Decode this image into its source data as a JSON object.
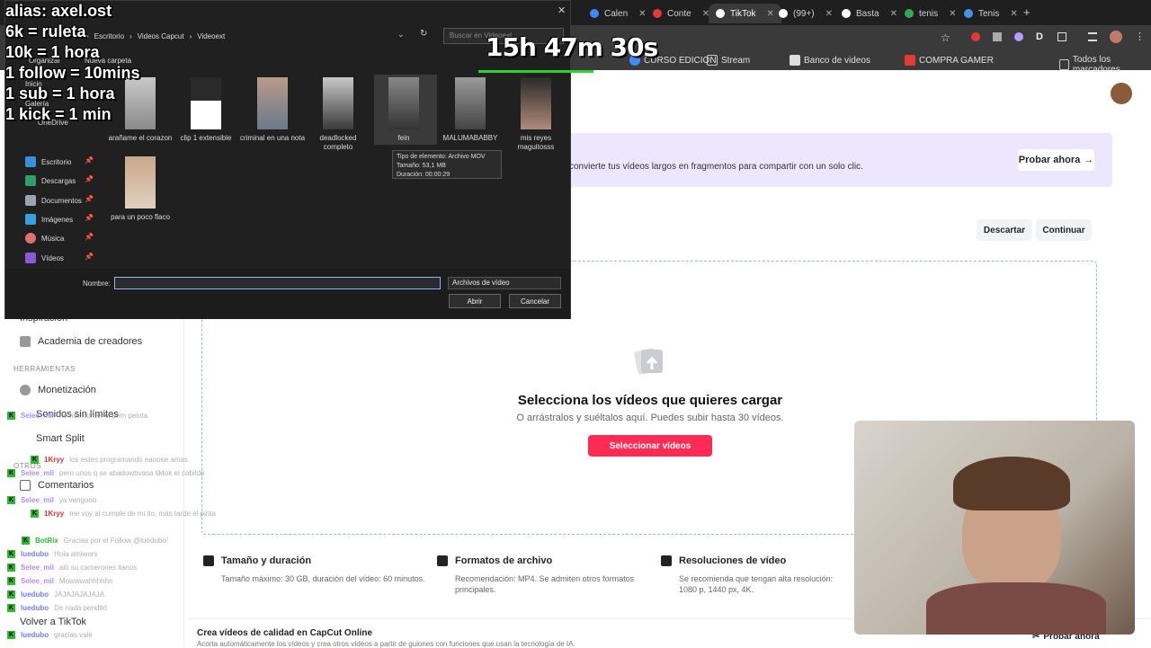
{
  "browser": {
    "tabs": [
      {
        "label": "Calen",
        "color": "#4285f4"
      },
      {
        "label": "Conte",
        "color": "#e53935"
      },
      {
        "label": "TikTok",
        "color": "#ffffff",
        "active": true
      },
      {
        "label": "(99+)",
        "color": "#ffffff"
      },
      {
        "label": "Basta",
        "color": "#ffffff"
      },
      {
        "label": "tenis",
        "color": "#34a853"
      },
      {
        "label": "Tenis",
        "color": "#4a90e2"
      }
    ],
    "bookmarks": [
      {
        "label": "CURSO EDICION",
        "color": "#3c8dff"
      },
      {
        "label": "Stream",
        "color": "#cccccc"
      },
      {
        "label": "Banco de videos",
        "color": "#cccccc"
      },
      {
        "label": "COMPRA GAMER",
        "color": "#e53935"
      },
      {
        "label": "Todos los marcadores",
        "color": "#cccccc"
      }
    ]
  },
  "dialog": {
    "path": [
      "Escritorio",
      "Videos Capcut",
      "Videoext"
    ],
    "search_placeholder": "Buscar en Videoext",
    "toolbar": {
      "organize": "Organizar",
      "new_folder": "Nueva carpeta"
    },
    "nav_top": [
      "Inicio",
      "Galería",
      "OneDrive"
    ],
    "nav_items": [
      "Escritorio",
      "Descargas",
      "Documentos",
      "Imágenes",
      "Música",
      "Vídeos"
    ],
    "files": [
      {
        "name": "arañame el corazon"
      },
      {
        "name": "clip 1 extensible"
      },
      {
        "name": "criminal en una nota"
      },
      {
        "name": "deadlocked completo"
      },
      {
        "name": "fein"
      },
      {
        "name": "MALUMABABBY"
      },
      {
        "name": "mis reyes maguitosss"
      },
      {
        "name": "para un poco flaco"
      }
    ],
    "tooltip": [
      "Tipo de elemento: Archivo MOV",
      "Tamaño: 53,1 MB",
      "Duración: 00:00:29"
    ],
    "name_label": "Nombre:",
    "name_value": "",
    "file_type": "Archivos de vídeo",
    "open_label": "Abrir",
    "cancel_label": "Cancelar"
  },
  "capcut": {
    "sidebar": {
      "items_top": [
        "Inspiración",
        "Academia de creadores"
      ],
      "section_tools": "HERRAMIENTAS",
      "tools": [
        "Monetización",
        "Sonidos sin límites",
        "Smart Split"
      ],
      "section_others": "OTROS",
      "others": [
        "Comentarios"
      ],
      "back": "Volver a TikTok"
    },
    "banner_text": "convierte tus vídeos largos en fragmentos para compartir con un solo clic.",
    "banner_button": "Probar ahora",
    "discard_label": "Descartar",
    "continue_label": "Continuar",
    "upload_title": "Selecciona los vídeos que quieres cargar",
    "upload_subtitle": "O arrástralos y suéltalos aquí. Puedes subir hasta 30 vídeos.",
    "upload_button": "Seleccionar vídeos",
    "features": [
      {
        "title": "Tamaño y duración",
        "text": "Tamaño máximo: 30 GB, duración del vídeo: 60 minutos."
      },
      {
        "title": "Formatos de archivo",
        "text": "Recomendación: MP4. Se admiten otros formatos principales."
      },
      {
        "title": "Resoluciones de vídeo",
        "text": "Se recomienda que tengan alta resolución: 1080 p, 1440 px, 4K."
      }
    ],
    "promo_title": "Crea vídeos de calidad en CapCut Online",
    "promo_text": "Acorta automáticamente los vídeos y crea otros vídeos a partir de guiones con funciones que usan la tecnología de IA.",
    "promo_button": "Probar ahora"
  },
  "overlay": {
    "lines": [
      "alias: axel.ost",
      "6k = ruleta",
      "10k = 1 hora",
      "1 follow = 10mins",
      "1 sub = 1 hora",
      "1 kick = 1 min"
    ],
    "timer": "15h 47m 30s"
  },
  "chat": [
    {
      "user": "Selee_mil",
      "msg": "no nos cortas el prim pelota",
      "color": "#b08cff"
    },
    {
      "user": "1Kryy",
      "msg": "los estes programando eaoose amas",
      "color": "#e0332e"
    },
    {
      "user": "Selee_mil",
      "msg": "pero unos q se abadowbvasa tiktok el cabildo",
      "color": "#b08cff"
    },
    {
      "user": "Selee_mil",
      "msg": "ya vengooo",
      "color": "#b08cff"
    },
    {
      "user": "1Kryy",
      "msg": "me voy al cumple de mi tio, más tarde el pinta",
      "color": "#e0332e"
    },
    {
      "user": "BotRix",
      "msg": "Gracias por el Follow @luedubo!",
      "color": "#2db92d"
    },
    {
      "user": "luedubo",
      "msg": "Hola amiwors",
      "color": "#7a7aff"
    },
    {
      "user": "Selee_mil",
      "msg": "aló su camerones llanos",
      "color": "#b08cff"
    },
    {
      "user": "Selee_mil",
      "msg": "Mowwwahhhhhn",
      "color": "#b08cff"
    },
    {
      "user": "luedubo",
      "msg": "JAJAJAJAJAJA",
      "color": "#7a7aff"
    },
    {
      "user": "luedubo",
      "msg": "De nada pendito",
      "color": "#7a7aff"
    },
    {
      "user": "luedubo",
      "msg": "gracias vale",
      "color": "#7a7aff"
    }
  ]
}
